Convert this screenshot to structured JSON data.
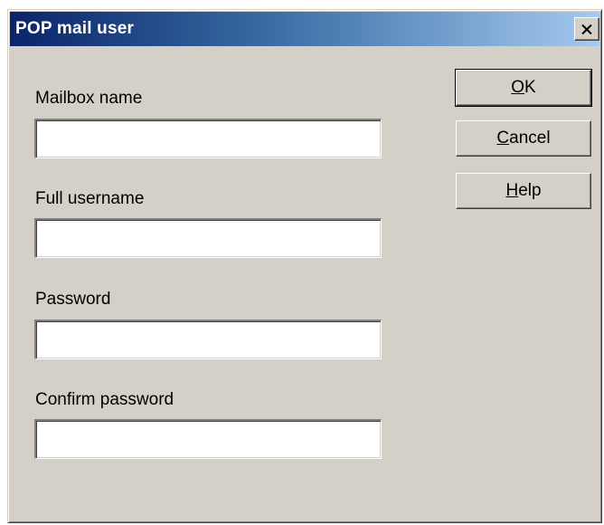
{
  "window": {
    "title": "POP mail user"
  },
  "fields": {
    "mailbox_name": {
      "label": "Mailbox name",
      "value": ""
    },
    "full_username": {
      "label": "Full username",
      "value": ""
    },
    "password": {
      "label": "Password",
      "value": ""
    },
    "confirm_password": {
      "label": "Confirm password",
      "value": ""
    }
  },
  "buttons": {
    "ok": {
      "accel": "O",
      "rest": "K"
    },
    "cancel": {
      "accel": "C",
      "rest": "ancel"
    },
    "help": {
      "accel": "H",
      "rest": "elp"
    }
  },
  "icons": {
    "close": "close-icon"
  },
  "colors": {
    "face": "#d4d0c8",
    "title_start": "#0a246a",
    "title_end": "#a6caf0"
  }
}
